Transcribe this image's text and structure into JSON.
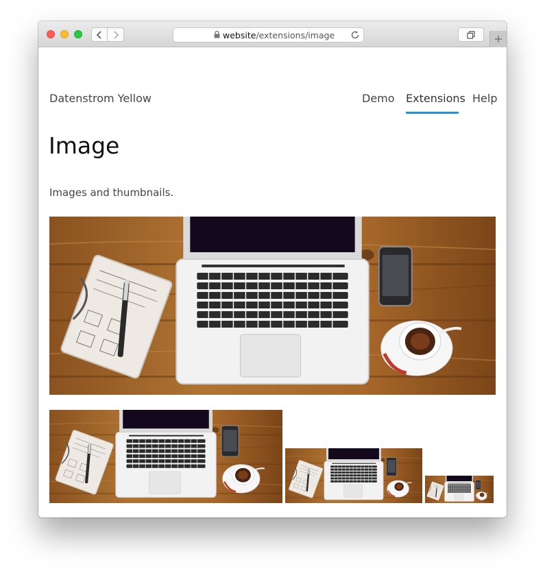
{
  "browser": {
    "url_host": "website",
    "url_path": "/extensions/image"
  },
  "site": {
    "name": "Datenstrom Yellow",
    "nav": [
      {
        "label": "Demo",
        "active": false
      },
      {
        "label": "Extensions",
        "active": true
      },
      {
        "label": "Help",
        "active": false
      }
    ]
  },
  "page": {
    "title": "Image",
    "description": "Images and thumbnails."
  },
  "images": [
    {
      "role": "main image",
      "subject": "laptop-notebook-coffee-desk-photo"
    },
    {
      "role": "thumbnail",
      "subject": "laptop-notebook-coffee-desk-photo"
    },
    {
      "role": "thumbnail",
      "subject": "laptop-notebook-coffee-desk-photo"
    },
    {
      "role": "thumbnail",
      "subject": "laptop-notebook-coffee-desk-photo"
    }
  ],
  "colors": {
    "accent": "#1f92e8",
    "wood": "#a8682a"
  }
}
